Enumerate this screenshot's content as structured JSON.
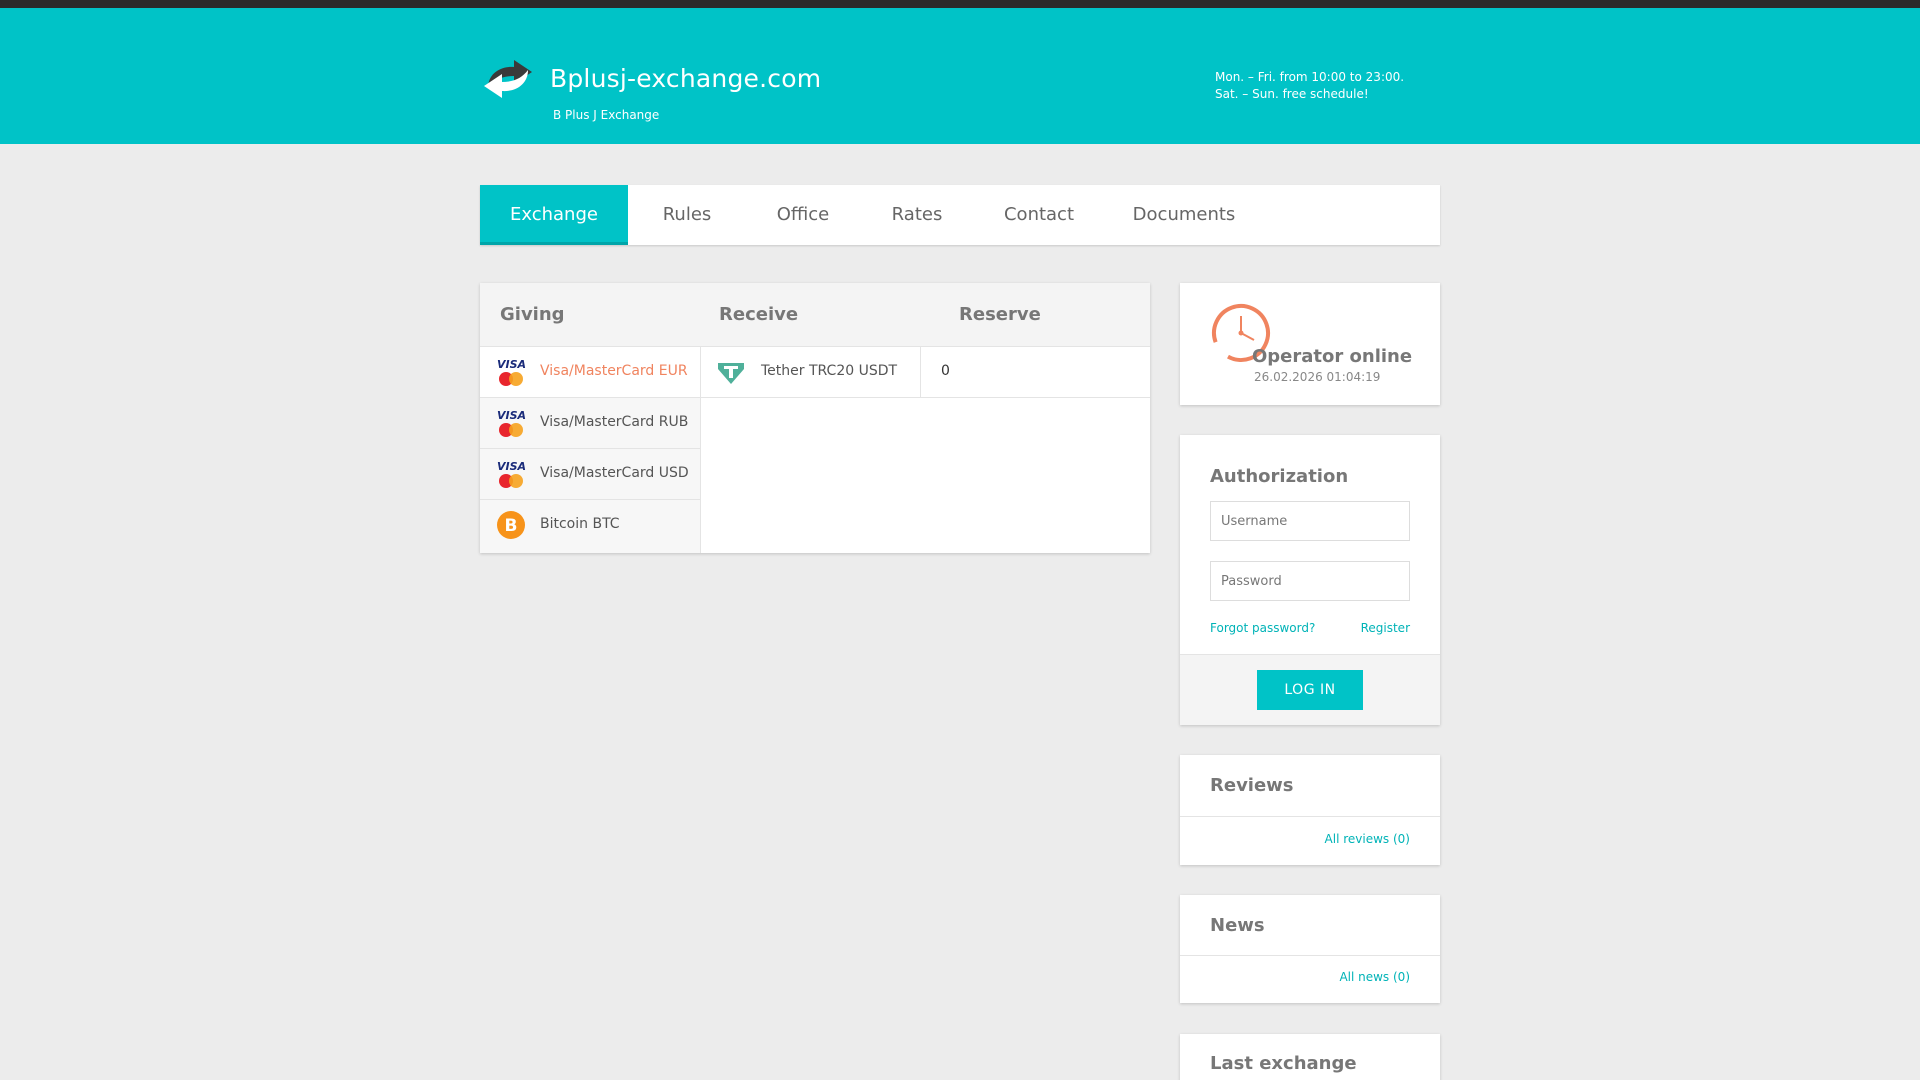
{
  "header": {
    "site_title": "Bplusj-exchange.com",
    "site_subtitle": "B Plus J Exchange",
    "hours_weekdays": "Mon. – Fri. from 10:00 to 23:00.",
    "hours_weekend": "Sat. – Sun. free schedule!",
    "logo_icon": "exchange-arrows-icon"
  },
  "nav": {
    "items": [
      "Exchange",
      "Rules",
      "Office",
      "Rates",
      "Contact",
      "Documents"
    ],
    "active": "Exchange"
  },
  "exchange_table": {
    "headers": {
      "giving": "Giving",
      "receive": "Receive",
      "reserve": "Reserve"
    },
    "giving": [
      {
        "label": "Visa/MasterCard EUR",
        "icon": "visa-mastercard-icon",
        "active": true
      },
      {
        "label": "Visa/MasterCard RUB",
        "icon": "visa-mastercard-icon",
        "active": false
      },
      {
        "label": "Visa/MasterCard USD",
        "icon": "visa-mastercard-icon",
        "active": false
      },
      {
        "label": "Bitcoin BTC",
        "icon": "bitcoin-icon",
        "active": false
      }
    ],
    "receive": [
      {
        "label": "Tether TRC20 USDT",
        "icon": "tether-icon",
        "reserve": "0"
      }
    ]
  },
  "operator": {
    "status": "Operator online",
    "datetime": "26.02.2026 01:04:19",
    "icon": "clock-icon"
  },
  "auth": {
    "title": "Authorization",
    "username_placeholder": "Username",
    "password_placeholder": "Password",
    "forgot_link": "Forgot password?",
    "register_link": "Register",
    "login_button": "LOG IN"
  },
  "reviews": {
    "title": "Reviews",
    "all_link": "All reviews (0)"
  },
  "news": {
    "title": "News",
    "all_link": "All news (0)"
  },
  "last_exchange": {
    "title": "Last exchange"
  },
  "colors": {
    "accent": "#00c3c7",
    "highlight": "#f0845f",
    "topline": "#2b2b2b",
    "background": "#ececec"
  }
}
